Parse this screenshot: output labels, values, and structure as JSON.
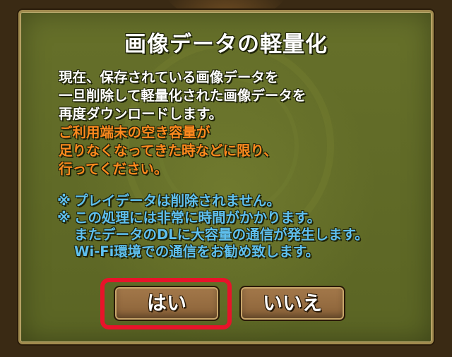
{
  "dialog": {
    "title": "画像データの軽量化",
    "description": [
      "現在、保存されている画像データを",
      "一旦削除して軽量化された画像データを",
      "再度ダウンロードします。"
    ],
    "warning": [
      "ご利用端末の空き容量が",
      "足りなくなってきた時などに限り、",
      "行ってください。"
    ],
    "notes": {
      "mark": "※",
      "note1": "プレイデータは削除されません。",
      "note2": "この処理には非常に時間がかかります。",
      "note2_cont1": "またデータのDLに大容量の通信が発生します。",
      "note2_cont2": "Wi-Fi環境での通信をお勧め致します。"
    },
    "buttons": {
      "yes": "はい",
      "no": "いいえ"
    }
  },
  "colors": {
    "panel": "#5f6927",
    "warning_text": "#ff8a1e",
    "note_text": "#5fc0f0",
    "highlight": "#e8132a"
  }
}
